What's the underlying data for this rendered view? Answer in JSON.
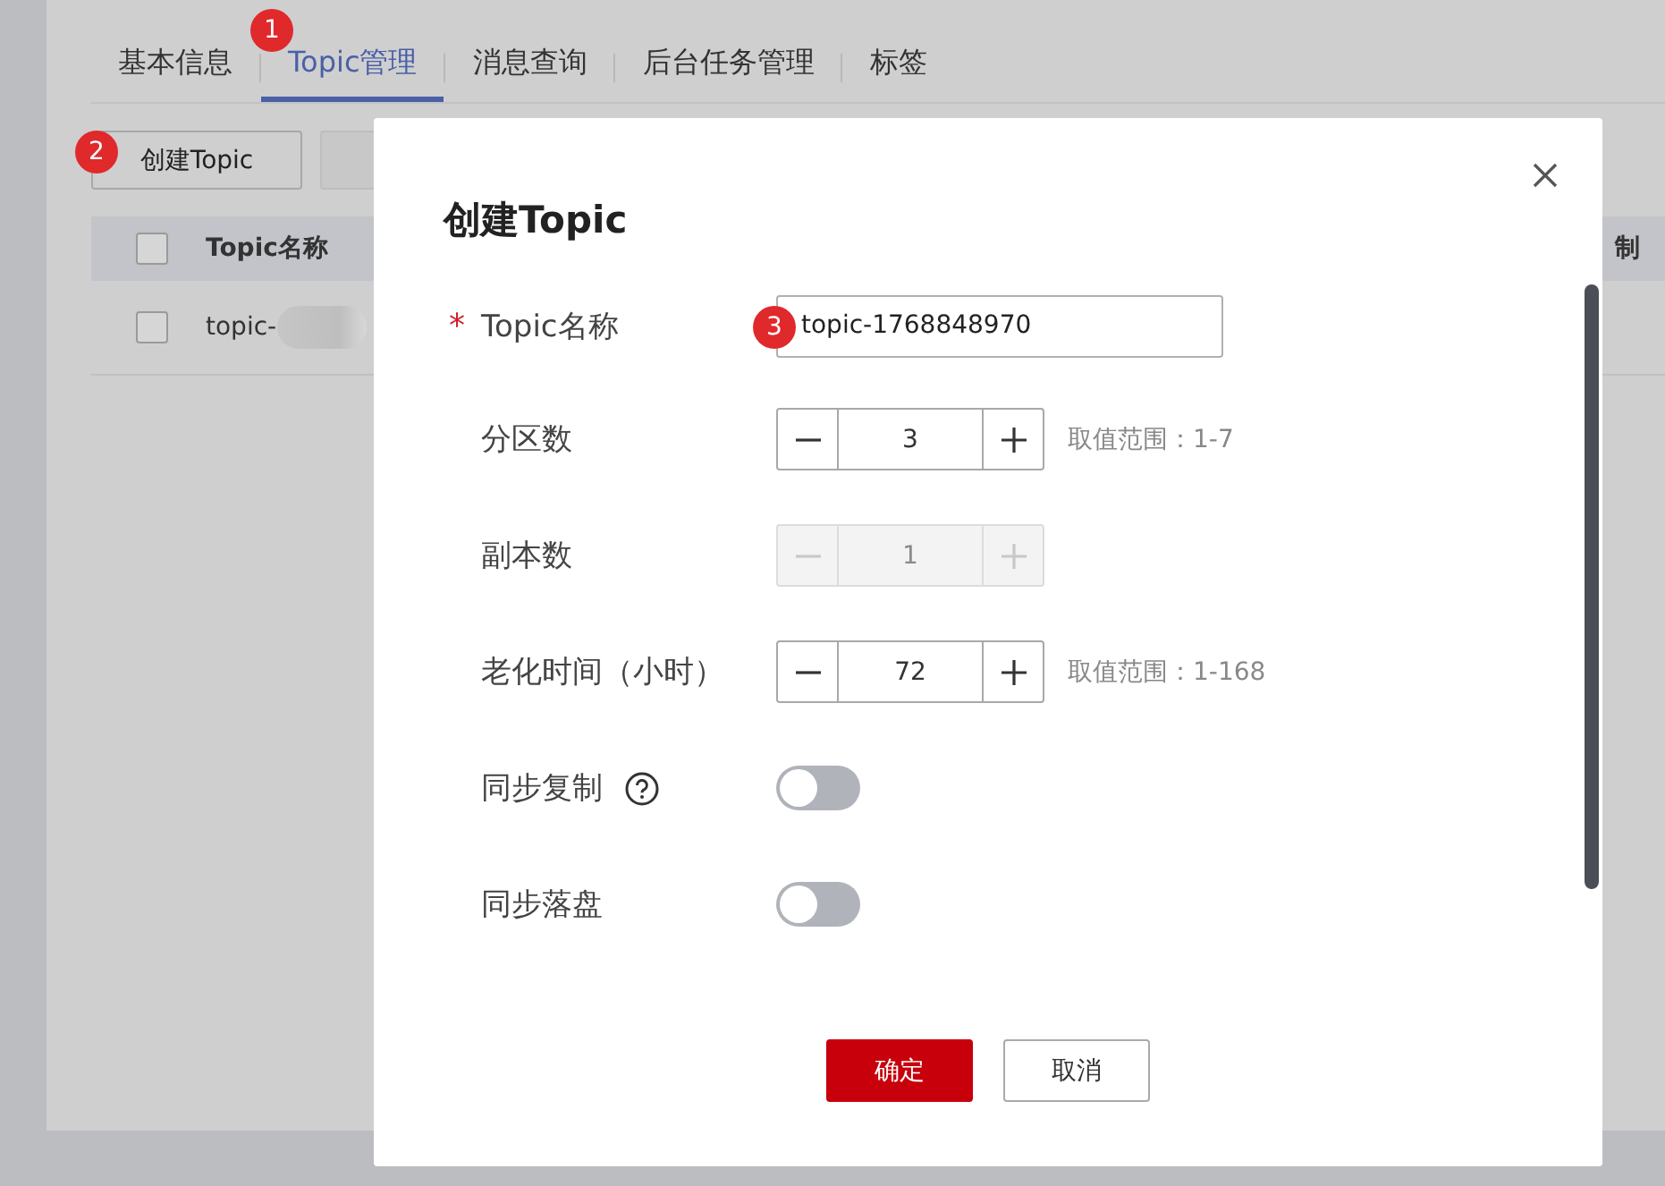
{
  "tabs": [
    {
      "label": "基本信息",
      "selected": false
    },
    {
      "label": "Topic管理",
      "selected": true,
      "marker": "1"
    },
    {
      "label": "消息查询",
      "selected": false
    },
    {
      "label": "后台任务管理",
      "selected": false
    },
    {
      "label": "标签",
      "selected": false
    }
  ],
  "toolbar": {
    "buttons": [
      {
        "label": "创建Topic",
        "disabled": false,
        "marker": "2"
      },
      {
        "disabled": true
      }
    ]
  },
  "table": {
    "header_checked": false,
    "columns": [
      "Topic名称",
      "制"
    ],
    "rows": [
      {
        "selected": false,
        "name": "topic-"
      }
    ]
  },
  "dialog": {
    "title": "创建Topic",
    "fields": [
      {
        "kind": "text",
        "label": "Topic名称",
        "required_mark": "*",
        "value": "topic-1768848970",
        "marker": "3"
      },
      {
        "kind": "number",
        "label": "分区数",
        "value": "3",
        "hint": "取值范围：1-7",
        "disabled": false
      },
      {
        "kind": "number",
        "label": "副本数",
        "value": "1",
        "disabled": true
      },
      {
        "kind": "number",
        "label": "老化时间（小时）",
        "value": "72",
        "hint": "取值范围：1-168",
        "disabled": false
      },
      {
        "kind": "switch",
        "label": "同步复制",
        "help": true,
        "on": false
      },
      {
        "kind": "switch",
        "label": "同步落盘",
        "on": false
      }
    ],
    "buttons": [
      {
        "label": "确定",
        "primary": true
      },
      {
        "label": "取消",
        "primary": false
      }
    ]
  }
}
